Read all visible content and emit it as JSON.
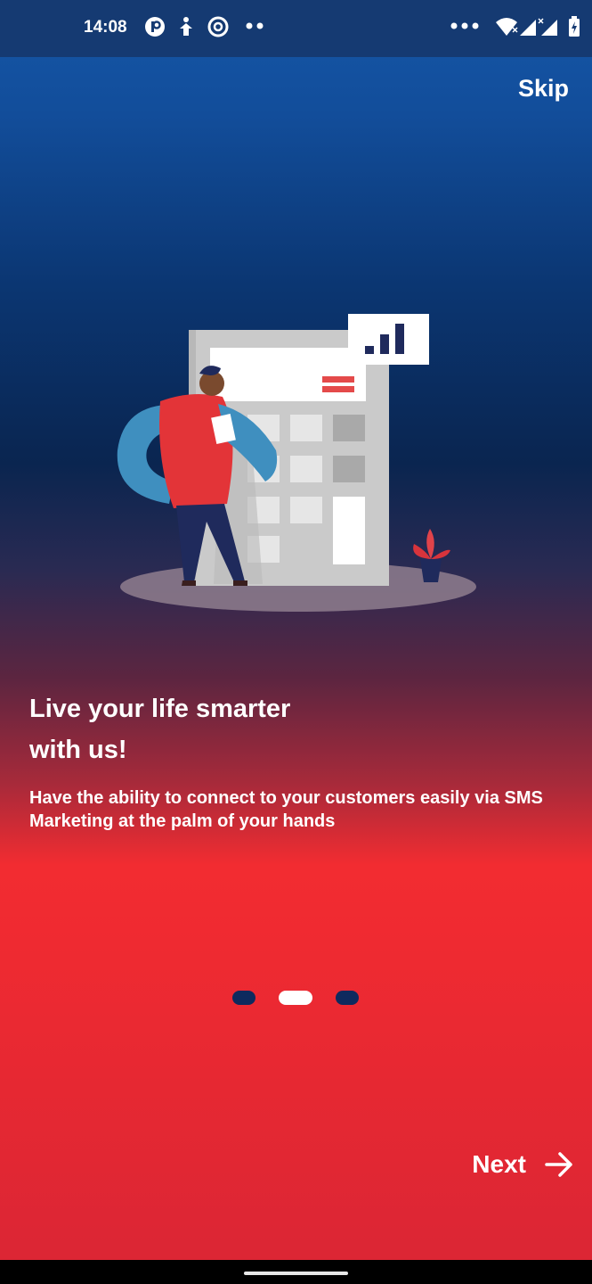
{
  "status_bar": {
    "time": "14:08",
    "left_icons": [
      "app-icon-p",
      "accessibility-icon",
      "pocket-casts-icon",
      "more-notifications-icon"
    ],
    "right_icons": [
      "more-dots-icon",
      "wifi-icon",
      "signal-icon",
      "battery-icon"
    ]
  },
  "onboarding": {
    "skip_label": "Skip",
    "headline": "Live your life smarter\nwith us!",
    "description": "Have the ability to connect to your customers easily via SMS Marketing at the palm of your hands",
    "page_indicator": {
      "total": 3,
      "active": 2
    },
    "next_label": "Next",
    "next_icon": "arrow-right-icon"
  },
  "colors": {
    "top_gradient": "#1557a8",
    "mid_gradient": "#0a2550",
    "bottom_gradient": "#ef2a31",
    "dot_inactive": "#0e2a5e",
    "dot_active": "#ffffff"
  }
}
